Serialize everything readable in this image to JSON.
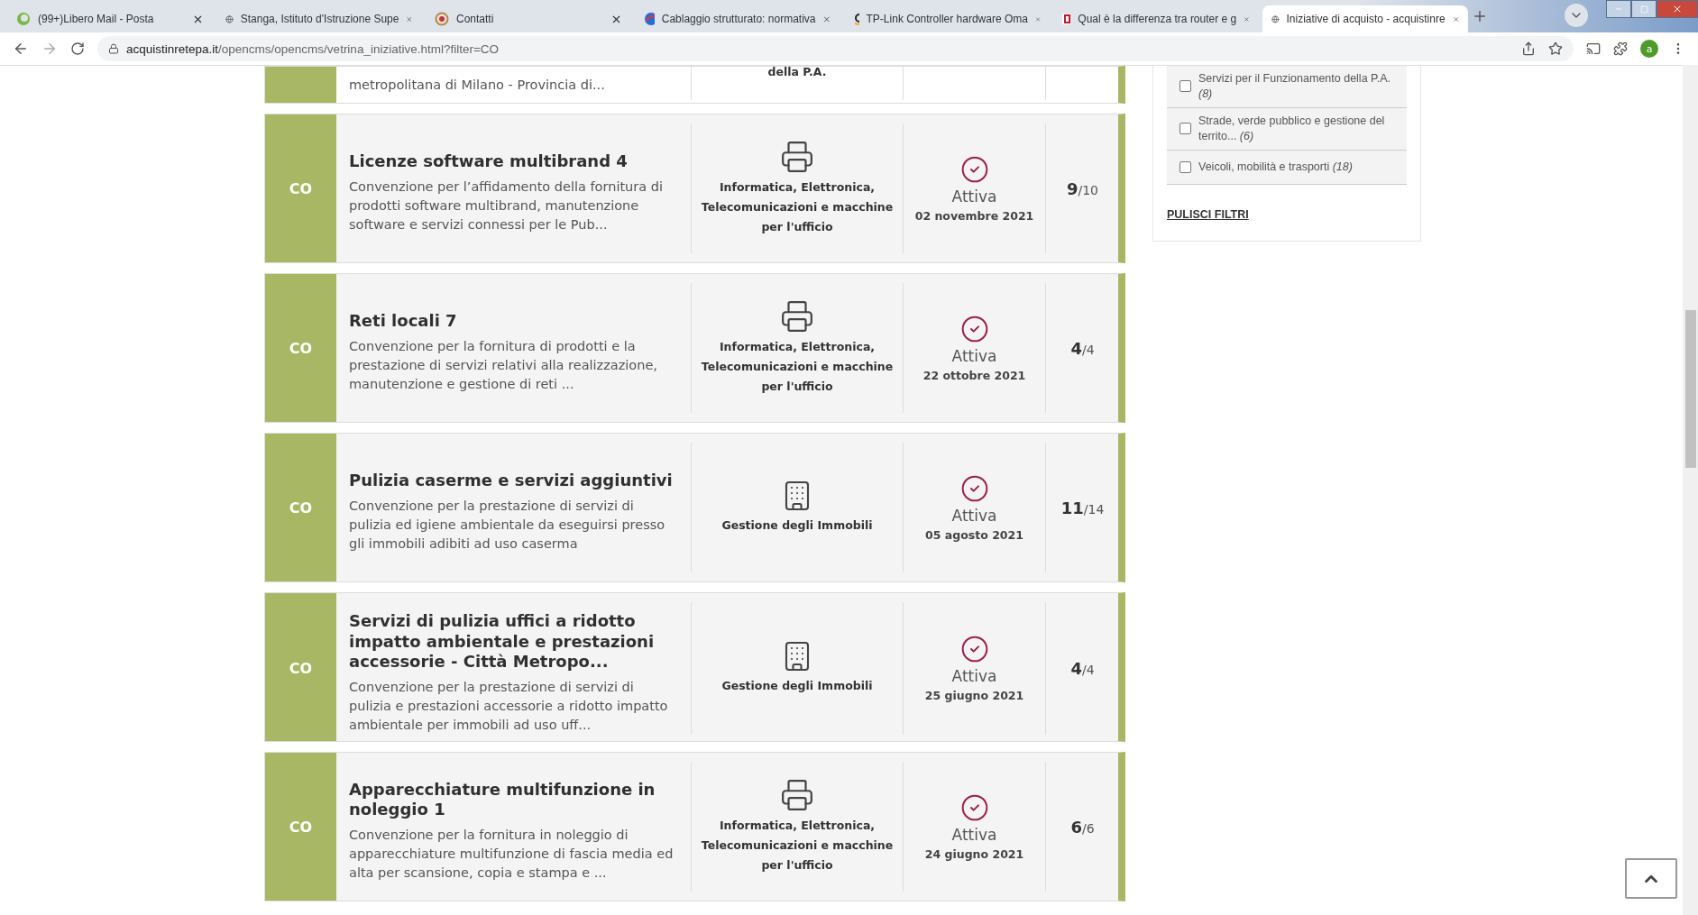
{
  "browser": {
    "tabs": [
      {
        "title": "(99+)Libero Mail - Posta",
        "selected": false
      },
      {
        "title": "Stanga, Istituto d'Istruzione Supe",
        "selected": false
      },
      {
        "title": "Contatti",
        "selected": false
      },
      {
        "title": "Cablaggio strutturato: normativa",
        "selected": false
      },
      {
        "title": "TP-Link Controller hardware Oma",
        "selected": false
      },
      {
        "title": "Qual è la differenza tra router e g",
        "selected": false
      },
      {
        "title": "Iniziative di acquisto - acquistinre",
        "selected": true
      }
    ],
    "url_host": "acquistinretepa.it",
    "url_path": "/opencms/opencms/vetrina_iniziative.html?filter=CO",
    "profile_initial": "a"
  },
  "partial_card": {
    "description": "metropolitana di Milano - Provincia di...",
    "category": "della P.A."
  },
  "cards": [
    {
      "code": "CO",
      "title": "Licenze software multibrand 4",
      "description": "Convenzione per l’affidamento della fornitura di prodotti software multibrand, manutenzione software e servizi connessi per le Pub...",
      "category": "Informatica, Elettronica, Telecomunicazioni e macchine per l'ufficio",
      "kind": "printer",
      "status": "Attiva",
      "date": "02 novembre 2021",
      "count": "**9**/10"
    },
    {
      "code": "CO",
      "title": "Reti locali 7",
      "description": "Convenzione per la fornitura di prodotti e la prestazione di servizi relativi alla realizzazione, manutenzione e gestione di reti ...",
      "category": "Informatica, Elettronica, Telecomunicazioni e macchine per l'ufficio",
      "kind": "printer",
      "status": "Attiva",
      "date": "22 ottobre 2021",
      "count": "**4**/4"
    },
    {
      "code": "CO",
      "title": "Pulizia caserme e servizi aggiuntivi",
      "description": "Convenzione per la prestazione di servizi di pulizia ed igiene ambientale da eseguirsi presso gli immobili adibiti ad uso caserma",
      "category": "Gestione degli Immobili",
      "kind": "building",
      "status": "Attiva",
      "date": "05 agosto 2021",
      "count": "**11**/14"
    },
    {
      "code": "CO",
      "title": "Servizi di pulizia uffici a ridotto impatto ambientale e prestazioni accessorie - Città Metropo...",
      "description": "Convenzione per la prestazione di servizi di pulizia e prestazioni accessorie a ridotto impatto ambientale per immobili ad uso uff...",
      "category": "Gestione degli Immobili",
      "kind": "building",
      "status": "Attiva",
      "date": "25 giugno 2021",
      "count": "**4**/4"
    },
    {
      "code": "CO",
      "title": "Apparecchiature multifunzione in noleggio 1",
      "description": "Convenzione per la fornitura in noleggio di apparecchiature multifunzione di fascia media ed alta per scansione, copia e stampa e ...",
      "category": "Informatica, Elettronica, Telecomunicazioni e macchine per l'ufficio",
      "kind": "printer",
      "status": "Attiva",
      "date": "24 giugno 2021",
      "count": "**6**/6"
    }
  ],
  "filters": {
    "options": [
      {
        "label": "Servizi per il Funzionamento della P.A. *(8)*",
        "checked": false
      },
      {
        "label": "Strade, verde pubblico e gestione del territo... *(6)*",
        "checked": false
      },
      {
        "label": "Veicoli, mobilità e trasporti *(18)*",
        "checked": false
      }
    ],
    "clear_link": "PULISCI FILTRI"
  }
}
